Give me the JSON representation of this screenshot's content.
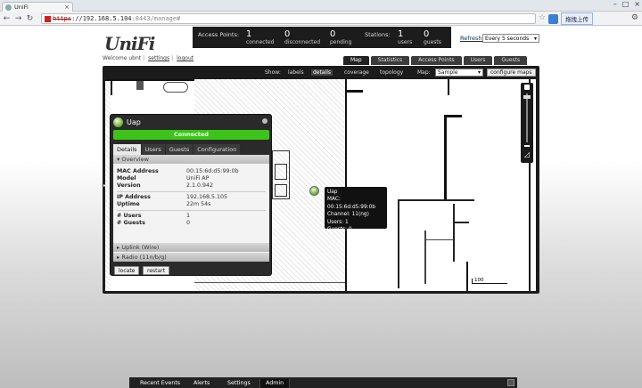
{
  "browser": {
    "tab_title": "UniFi",
    "url_scheme": "https",
    "url_host": "://192.168.5.104",
    "url_path": ":8443/manage#",
    "extension_label": "拖拽上传"
  },
  "header": {
    "logo": "UniFi",
    "welcome": "Welcome ubnt",
    "settings_link": "settings",
    "logout_link": "logout",
    "stats": {
      "access_points_label": "Access Points:",
      "connected_value": "1",
      "connected_label": "connected",
      "disconnected_value": "0",
      "disconnected_label": "disconnected",
      "pending_value": "0",
      "pending_label": "pending",
      "stations_label": "Stations:",
      "users_value": "1",
      "users_label": "users",
      "guests_value": "0",
      "guests_label": "guests"
    },
    "refresh_label": "Refresh:",
    "refresh_value": "Every 5 seconds",
    "tabs": [
      "Map",
      "Statistics",
      "Access Points",
      "Users",
      "Guests"
    ]
  },
  "map_toolbar": {
    "show_label": "Show:",
    "labels": "labels",
    "details": "details",
    "coverage": "coverage",
    "topology": "topology",
    "map_label": "Map:",
    "map_value": "Sample",
    "configure": "configure maps"
  },
  "scale_label": "100",
  "tooltip": {
    "lines": [
      "Uap",
      "MAC: 00:15:6d:d5:99:0b",
      "Channel: 11(ng)",
      "Users: 1",
      "Guests: 0"
    ]
  },
  "ap_panel": {
    "name": "Uap",
    "status": "Connected",
    "tabs": [
      "Details",
      "Users",
      "Guests",
      "Configuration"
    ],
    "overview_label": "▾ Overview",
    "rows": {
      "mac_k": "MAC Address",
      "mac_v": "00:15:6d:d5:99:0b",
      "model_k": "Model",
      "model_v": "UniFi AP",
      "version_k": "Version",
      "version_v": "2.1.0.942",
      "ip_k": "IP Address",
      "ip_v": "192.168.5.105",
      "uptime_k": "Uptime",
      "uptime_v": "22m 54s",
      "users_k": "# Users",
      "users_v": "1",
      "guests_k": "# Guests",
      "guests_v": "0"
    },
    "uplink_label": "▸ Uplink (Wire)",
    "radio_label": "▸ Radio (11n/b/g)",
    "locate": "locate",
    "restart": "restart"
  },
  "bottom_tabs": [
    "Recent Events",
    "Alerts",
    "Settings",
    "Admin"
  ]
}
